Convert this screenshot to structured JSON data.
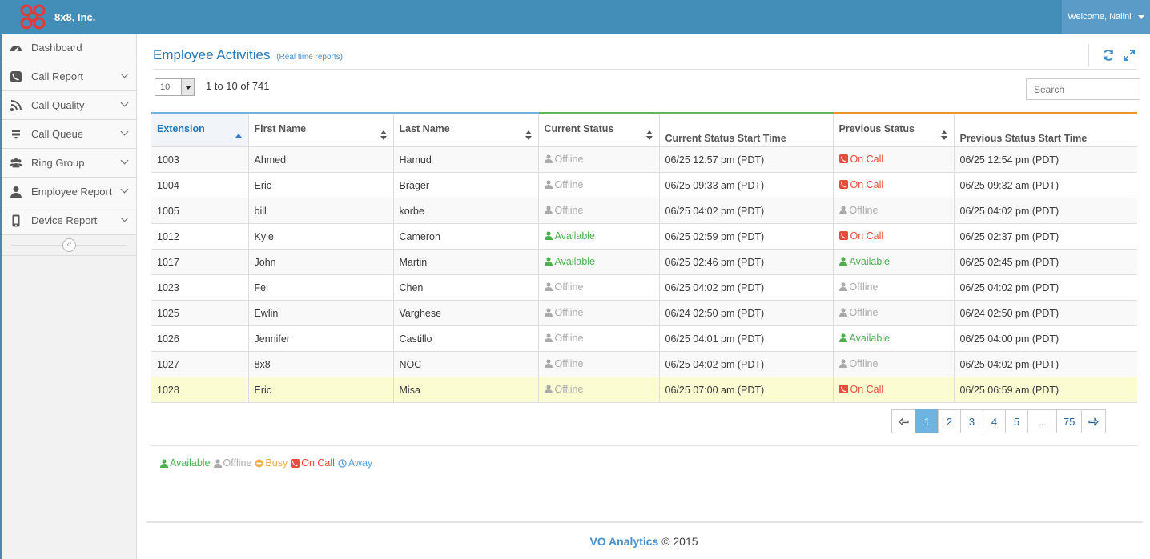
{
  "brand": {
    "name": "8x8, Inc."
  },
  "user": {
    "welcome": "Welcome, Nalini"
  },
  "sidebar": {
    "items": [
      {
        "label": "Dashboard",
        "icon": "dashboard-icon",
        "expandable": false
      },
      {
        "label": "Call Report",
        "icon": "phone-icon",
        "expandable": true
      },
      {
        "label": "Call Quality",
        "icon": "rss-icon",
        "expandable": true
      },
      {
        "label": "Call Queue",
        "icon": "queue-icon",
        "expandable": true
      },
      {
        "label": "Ring Group",
        "icon": "users-icon",
        "expandable": true
      },
      {
        "label": "Employee Report",
        "icon": "user-icon",
        "expandable": true
      },
      {
        "label": "Device Report",
        "icon": "mobile-icon",
        "expandable": true
      }
    ],
    "collapse_glyph": "«"
  },
  "page": {
    "title": "Employee Activities",
    "subtitle": "(Real time reports)"
  },
  "table_controls": {
    "page_length": "10",
    "range_info": "1 to 10 of 741",
    "search_placeholder": "Search"
  },
  "table": {
    "columns": [
      "Extension",
      "First Name",
      "Last Name",
      "Current Status",
      "Current Status Start Time",
      "Previous Status",
      "Previous Status Start Time"
    ],
    "rows": [
      {
        "ext": "1003",
        "first": "Ahmed",
        "last": "Hamud",
        "cur": "Offline",
        "cur_time": "06/25 12:57 pm (PDT)",
        "prev": "On Call",
        "prev_time": "06/25 12:54 pm (PDT)"
      },
      {
        "ext": "1004",
        "first": "Eric",
        "last": "Brager",
        "cur": "Offline",
        "cur_time": "06/25 09:33 am (PDT)",
        "prev": "On Call",
        "prev_time": "06/25 09:32 am (PDT)"
      },
      {
        "ext": "1005",
        "first": "bill",
        "last": "korbe",
        "cur": "Offline",
        "cur_time": "06/25 04:02 pm (PDT)",
        "prev": "Offline",
        "prev_time": "06/25 04:02 pm (PDT)"
      },
      {
        "ext": "1012",
        "first": "Kyle",
        "last": "Cameron",
        "cur": "Available",
        "cur_time": "06/25 02:59 pm (PDT)",
        "prev": "On Call",
        "prev_time": "06/25 02:37 pm (PDT)"
      },
      {
        "ext": "1017",
        "first": "John",
        "last": "Martin",
        "cur": "Available",
        "cur_time": "06/25 02:46 pm (PDT)",
        "prev": "Available",
        "prev_time": "06/25 02:45 pm (PDT)"
      },
      {
        "ext": "1023",
        "first": "Fei",
        "last": "Chen",
        "cur": "Offline",
        "cur_time": "06/25 04:02 pm (PDT)",
        "prev": "Offline",
        "prev_time": "06/25 04:02 pm (PDT)"
      },
      {
        "ext": "1025",
        "first": "Ewlin",
        "last": "Varghese",
        "cur": "Offline",
        "cur_time": "06/24 02:50 pm (PDT)",
        "prev": "Offline",
        "prev_time": "06/24 02:50 pm (PDT)"
      },
      {
        "ext": "1026",
        "first": "Jennifer",
        "last": "Castillo",
        "cur": "Offline",
        "cur_time": "06/25 04:01 pm (PDT)",
        "prev": "Available",
        "prev_time": "06/25 04:00 pm (PDT)"
      },
      {
        "ext": "1027",
        "first": "8x8",
        "last": "NOC",
        "cur": "Offline",
        "cur_time": "06/25 04:02 pm (PDT)",
        "prev": "Offline",
        "prev_time": "06/25 04:02 pm (PDT)"
      },
      {
        "ext": "1028",
        "first": "Eric",
        "last": "Misa",
        "cur": "Offline",
        "cur_time": "06/25 07:00 am (PDT)",
        "prev": "On Call",
        "prev_time": "06/25 06:59 am (PDT)"
      }
    ]
  },
  "pagination": {
    "pages": [
      "1",
      "2",
      "3",
      "4",
      "5",
      "...",
      "75"
    ],
    "active": "1"
  },
  "legend": [
    {
      "label": "Available",
      "status": "available"
    },
    {
      "label": "Offline",
      "status": "offline"
    },
    {
      "label": "Busy",
      "status": "busy"
    },
    {
      "label": "On Call",
      "status": "oncall"
    },
    {
      "label": "Away",
      "status": "away"
    }
  ],
  "footer": {
    "product": "VO Analytics",
    "copyright": "© 2015"
  },
  "colors": {
    "topbar": "#438eb9",
    "available": "#4caf50",
    "offline": "#aaaaaa",
    "oncall": "#e74c3c",
    "busy": "#f0ad4e",
    "away": "#5ba4d8",
    "highlight_row": "#fcfcd2"
  }
}
